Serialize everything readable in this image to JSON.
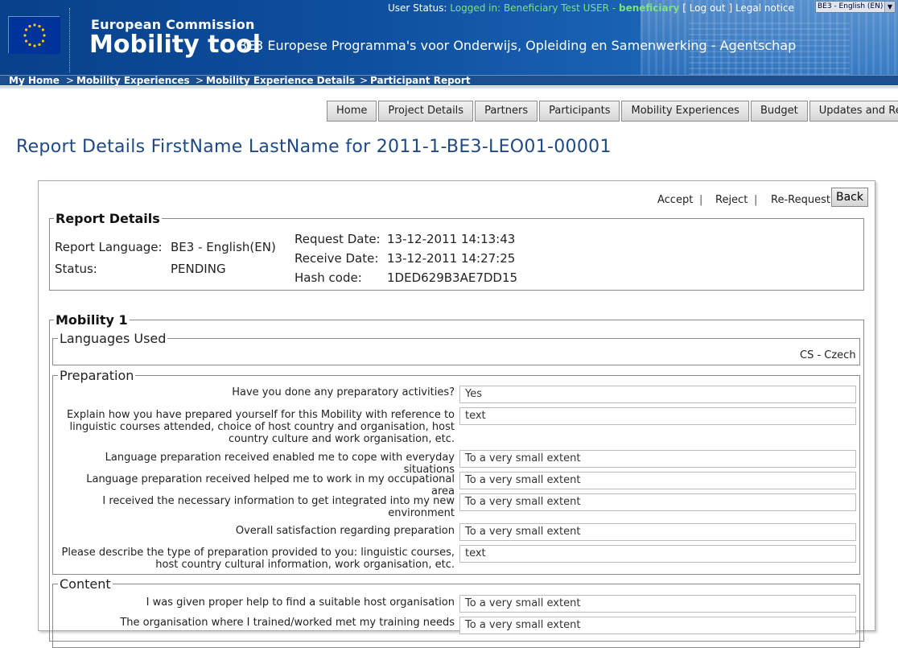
{
  "header": {
    "brand_top": "European Commission",
    "brand_main": "Mobility tool",
    "agency": "BE3 Europese Programma's voor Onderwijs, Opleiding en Samenwerking - Agentschap",
    "user_status_label": "User Status:",
    "user_status_value": "Logged in: Beneficiary Test USER -",
    "user_role": "beneficiary",
    "bracket_open": "[",
    "logout": "Log out",
    "bracket_close": "]",
    "legal_notice": "Legal notice",
    "language": "BE3 - English (EN)"
  },
  "breadcrumb": {
    "items": [
      "My Home",
      "Mobility Experiences",
      "Mobility Experience Details",
      "Participant Report"
    ],
    "sep": ">"
  },
  "nav": {
    "items": [
      "Home",
      "Project Details",
      "Partners",
      "Participants",
      "Mobility Experiences",
      "Budget",
      "Updates and Reports"
    ]
  },
  "page_title": "Report Details FirstName LastName for 2011-1-BE3-LEO01-00001",
  "actions": {
    "accept": "Accept",
    "reject": "Reject",
    "rerequest": "Re-Request",
    "divider": "|",
    "back": "Back"
  },
  "report": {
    "legend": "Report Details",
    "language_label": "Report Language:",
    "language_value": "BE3 - English(EN)",
    "status_label": "Status:",
    "status_value": "PENDING",
    "request_date_label": "Request Date:",
    "request_date_value": "13-12-2011 14:13:43",
    "receive_date_label": "Receive Date:",
    "receive_date_value": "13-12-2011 14:27:25",
    "hash_label": "Hash code:",
    "hash_value": "1DED629B3AE7DD15"
  },
  "mobility": {
    "legend": "Mobility 1",
    "languages_legend": "Languages Used",
    "languages_value": "CS - Czech",
    "preparation_legend": "Preparation",
    "preparation": [
      {
        "q": "Have you done any preparatory activities?",
        "a": "Yes"
      },
      {
        "q": "Explain how you have prepared yourself for this Mobility with reference to linguistic courses attended, choice of host country and organisation, host country culture and work organisation, etc.",
        "a": "text"
      },
      {
        "q": "Language preparation received enabled me to cope with everyday situations",
        "a": "To a very small extent"
      },
      {
        "q": "Language preparation received helped me to work in my occupational area",
        "a": "To a very small extent"
      },
      {
        "q": "I received the necessary information to get integrated into my new environment",
        "a": "To a very small extent"
      },
      {
        "q": "Overall satisfaction regarding preparation",
        "a": "To a very small extent"
      },
      {
        "q": "Please describe the type of preparation provided to you: linguistic courses, host country cultural information, work organisation, etc.",
        "a": "text"
      }
    ],
    "content_legend": "Content",
    "content": [
      {
        "q": "I was given proper help to find a suitable host organisation",
        "a": "To a very small extent"
      },
      {
        "q": "The organisation where I trained/worked met my training needs",
        "a": "To a very small extent"
      }
    ]
  }
}
